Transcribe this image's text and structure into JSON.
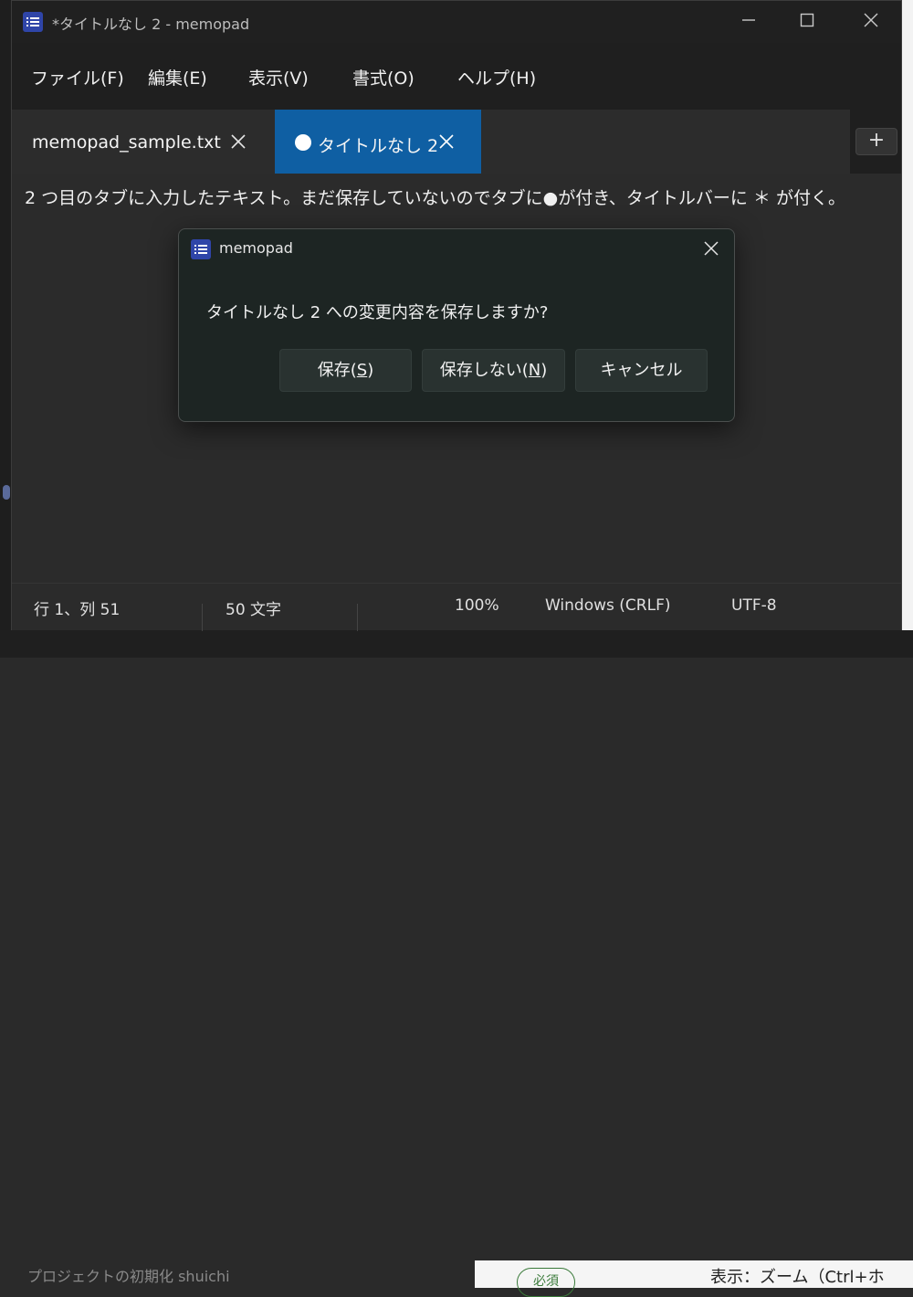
{
  "window": {
    "title": "*タイトルなし 2 - memopad"
  },
  "menu": {
    "items": [
      "ファイル(F)",
      "編集(E)",
      "表示(V)",
      "書式(O)",
      "ヘルプ(H)"
    ]
  },
  "tabs": [
    {
      "label": "memopad_sample.txt",
      "active": false,
      "modified": false
    },
    {
      "label": "タイトルなし 2",
      "active": true,
      "modified": true
    }
  ],
  "new_tab_label": "+",
  "editor": {
    "text": "2 つ目のタブに入力したテキスト。まだ保存していないのでタブに●が付き、タイトルバーに ＊ が付く。"
  },
  "status": {
    "position": "行 1、列 51",
    "char_count": "50 文字",
    "zoom": "100%",
    "line_ending": "Windows (CRLF)",
    "encoding": "UTF-8"
  },
  "dialog": {
    "title": "memopad",
    "message": "タイトルなし 2 への変更内容を保存しますか?",
    "buttons": {
      "save": {
        "text": "保存(",
        "key": "S",
        "end": ")"
      },
      "dont_save": {
        "text": "保存しない(",
        "key": "N",
        "end": ")"
      },
      "cancel": "キャンセル"
    }
  },
  "background": {
    "bottom_left_text": "プロジェクトの初期化 shuichi",
    "badge": "必須",
    "bottom_right_text": "表示：ズーム（Ctrl+ホ"
  },
  "colors": {
    "active_tab": "#0f5fa3",
    "window_bg": "#1f1f1f",
    "editor_bg": "#2b2b2b",
    "dialog_bg": "#1d2523",
    "app_icon": "#2f45a8"
  }
}
